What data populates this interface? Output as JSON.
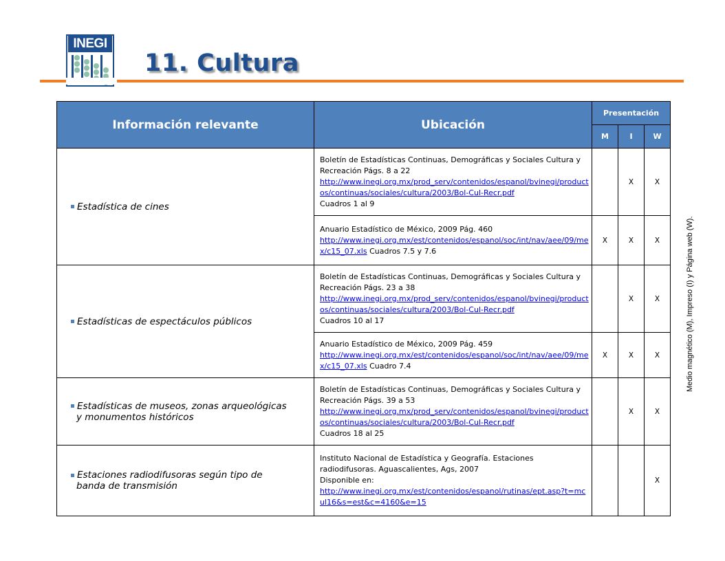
{
  "logo": {
    "text": "INEGI"
  },
  "page_title": "11. Cultura",
  "table": {
    "headers": {
      "info": "Información relevante",
      "location": "Ubicación",
      "presentation": "Presentación",
      "m": "M",
      "i": "I",
      "w": "W"
    },
    "groups": [
      {
        "topic": "Estadística de cines",
        "entries": [
          {
            "pre": "Boletín de Estadísticas Continuas, Demográficas y Sociales Cultura y Recreación  Págs. 8  a 22",
            "link": "http://www.inegi.org.mx/prod_serv/contenidos/espanol/bvinegi/productos/continuas/sociales/cultura/2003/Bol-Cul-Recr.pdf",
            "post": "Cuadros  1  al 9",
            "m": "",
            "i": "X",
            "w": "X"
          },
          {
            "pre": "Anuario Estadístico de México, 2009  Pág. 460",
            "link": "http://www.inegi.org.mx/est/contenidos/espanol/soc/int/nav/aee/09/mex/c15_07.xls",
            "post": "Cuadros 7.5 y 7.6",
            "m": "X",
            "i": "X",
            "w": "X"
          }
        ]
      },
      {
        "topic": "Estadísticas de espectáculos  públicos",
        "entries": [
          {
            "pre": "Boletín de Estadísticas Continuas, Demográficas y Sociales Cultura y Recreación  Págs. 23  a 38",
            "link": "http://www.inegi.org.mx/prod_serv/contenidos/espanol/bvinegi/productos/continuas/sociales/cultura/2003/Bol-Cul-Recr.pdf",
            "post": "Cuadros  10  al 17",
            "m": "",
            "i": "X",
            "w": "X"
          },
          {
            "pre": "Anuario Estadístico de México, 2009  Pág. 459",
            "link": "http://www.inegi.org.mx/est/contenidos/espanol/soc/int/nav/aee/09/mex/c15_07.xls",
            "post": "Cuadro 7.4",
            "m": "X",
            "i": "X",
            "w": "X"
          }
        ]
      },
      {
        "topic": "Estadísticas de museos, zonas arqueológicas",
        "topic_line2": "y monumentos históricos",
        "entries": [
          {
            "pre": "Boletín de Estadísticas Continuas, Demográficas y Sociales Cultura y Recreación  Págs. 39  a 53",
            "link": "http://www.inegi.org.mx/prod_serv/contenidos/espanol/bvinegi/productos/continuas/sociales/cultura/2003/Bol-Cul-Recr.pdf",
            "post": "Cuadros  18  al 25",
            "m": "",
            "i": "X",
            "w": "X"
          }
        ]
      },
      {
        "topic": "Estaciones  radiodifusoras  según  tipo  de",
        "topic_line2": "banda de transmisión",
        "entries": [
          {
            "pre": "Instituto Nacional de Estadística y Geografía. Estaciones radiodifusoras. Aguascalientes, Ags, 2007",
            "pre2": "Disponible en:",
            "link": "http://www.inegi.org.mx/est/contenidos/espanol/rutinas/ept.asp?t=mcul16&s=est&c=4160&e=15",
            "post": "",
            "m": "",
            "i": "",
            "w": "X"
          }
        ]
      }
    ]
  },
  "side_note": "Medio magnético (M), Impreso (I) y Página web (W).",
  "colors": {
    "header_blue": "#4f81bd",
    "title_blue": "#1f4f8f",
    "rule_orange": "#f07e26"
  }
}
